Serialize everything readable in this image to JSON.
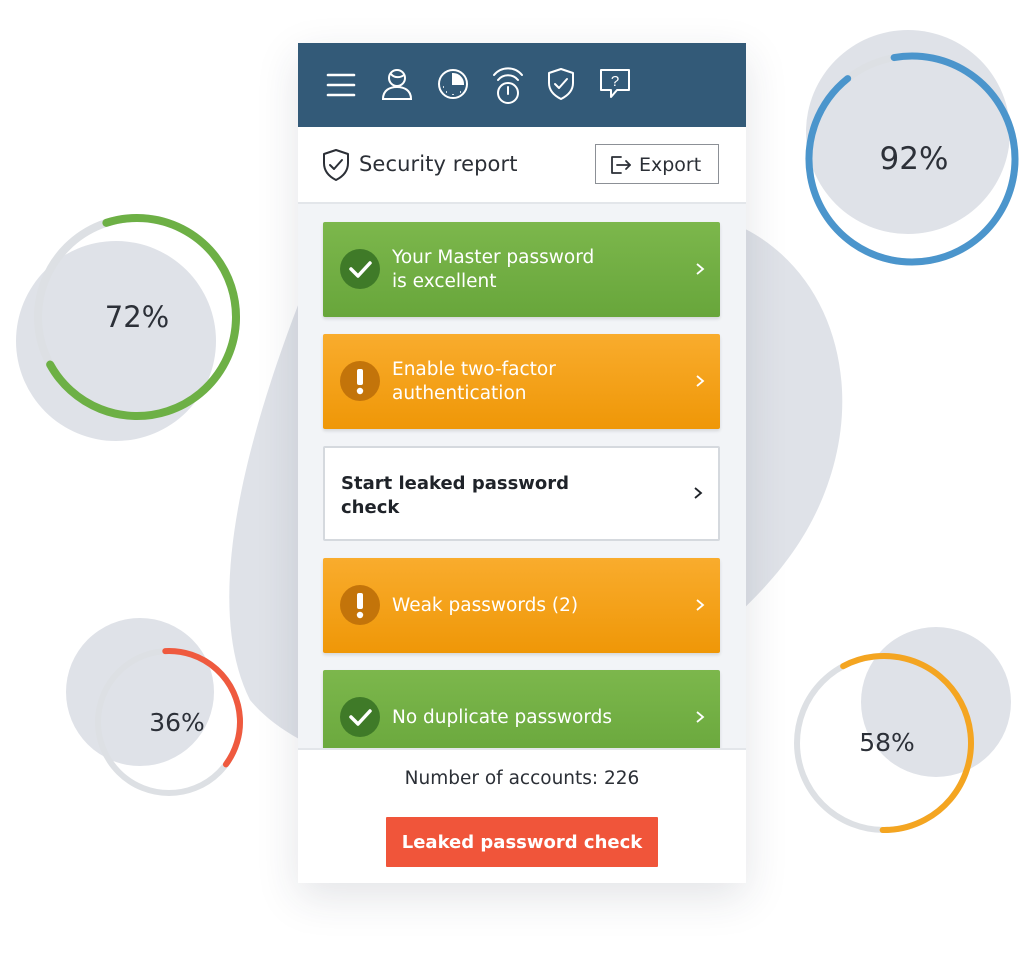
{
  "toolbar": {
    "icons": [
      "menu-icon",
      "user-icon",
      "dashboard-icon",
      "remote-access-icon",
      "security-shield-icon",
      "help-icon"
    ]
  },
  "report": {
    "title": "Security report",
    "export_label": "Export"
  },
  "cards": [
    {
      "status": "ok",
      "label": "Your Master password\nis excellent"
    },
    {
      "status": "warning",
      "label": "Enable two-factor\nauthentication"
    },
    {
      "status": "neutral",
      "label": "Start leaked password check"
    },
    {
      "status": "warning",
      "label": "Weak passwords (2)"
    },
    {
      "status": "ok",
      "label": "No duplicate passwords"
    }
  ],
  "footer": {
    "accounts_text": "Number of accounts: 226",
    "button_label": "Leaked password check"
  },
  "rings": [
    {
      "label": "72%",
      "percent": 72,
      "color": "#6db045"
    },
    {
      "label": "92%",
      "percent": 92,
      "color": "#4b95cc"
    },
    {
      "label": "36%",
      "percent": 36,
      "color": "#ef5a3f"
    },
    {
      "label": "58%",
      "percent": 58,
      "color": "#f4a521"
    }
  ],
  "colors": {
    "topbar": "#335a78",
    "ok": "#72ad42",
    "warning": "#f5a11a",
    "action": "#f0553a"
  }
}
